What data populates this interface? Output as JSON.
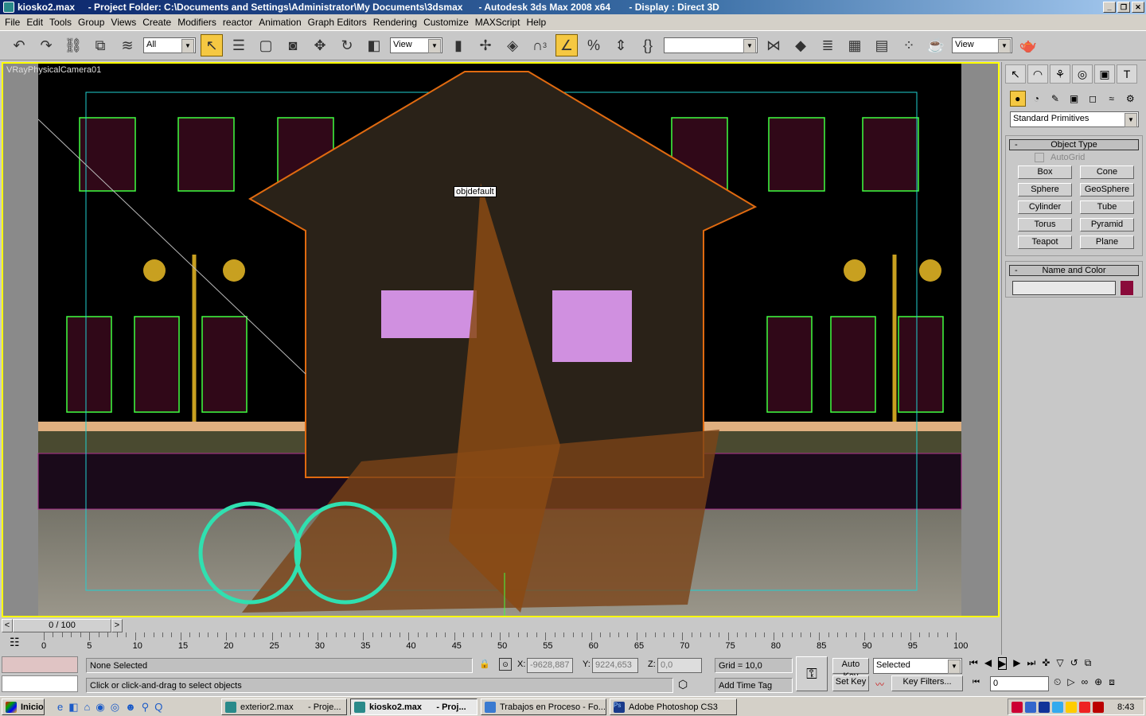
{
  "window": {
    "title": "kiosko2.max     - Project Folder: C:\\Documents and Settings\\Administrator\\My Documents\\3dsmax      - Autodesk 3ds Max 2008 x64       - Display : Direct 3D",
    "controls": [
      "_",
      "❐",
      "✕"
    ]
  },
  "menu": [
    "File",
    "Edit",
    "Tools",
    "Group",
    "Views",
    "Create",
    "Modifiers",
    "reactor",
    "Animation",
    "Graph Editors",
    "Rendering",
    "Customize",
    "MAXScript",
    "Help"
  ],
  "toolbar": {
    "selection_filter": "All",
    "ref_coord": "View",
    "named_sel": "",
    "view2": "View",
    "snap_label": "3"
  },
  "viewport": {
    "label": "VRayPhysicalCamera01",
    "tooltip": "objdefault",
    "border_color": "#ffff00"
  },
  "panel": {
    "category": "Standard Primitives",
    "object_type": "Object Type",
    "autogrid": "AutoGrid",
    "buttons": [
      "Box",
      "Cone",
      "Sphere",
      "GeoSphere",
      "Cylinder",
      "Tube",
      "Torus",
      "Pyramid",
      "Teapot",
      "Plane"
    ],
    "name_color": "Name and Color",
    "name_value": "",
    "color_swatch": "#8a0a3a",
    "collapse": "-"
  },
  "timeline": {
    "position": "0 / 100",
    "prev": "<",
    "next": ">",
    "ticks": [
      "0",
      "5",
      "10",
      "15",
      "20",
      "25",
      "30",
      "35",
      "40",
      "45",
      "50",
      "55",
      "60",
      "65",
      "70",
      "75",
      "80",
      "85",
      "90",
      "95",
      "100"
    ]
  },
  "status": {
    "selection": "None Selected",
    "prompt": "Click or click-and-drag to select objects",
    "x_label": "X:",
    "x": "-9628,887",
    "y_label": "Y:",
    "y": "9224,653",
    "z_label": "Z:",
    "z": "0,0",
    "grid": "Grid = 10,0",
    "time_tag": "Add Time Tag",
    "auto_key": "Auto Key",
    "set_key": "Set Key",
    "key_mode": "Selected",
    "key_filters": "Key Filters...",
    "frame": "0"
  },
  "taskbar": {
    "start": "Inicio",
    "tasks": [
      {
        "label": "exterior2.max      - Proje...",
        "active": false
      },
      {
        "label": "kiosko2.max      - Proj...",
        "active": true
      },
      {
        "label": "Trabajos en Proceso - Fo...",
        "active": false
      },
      {
        "label": "Adobe Photoshop CS3",
        "active": false
      }
    ],
    "clock": "8:43"
  }
}
